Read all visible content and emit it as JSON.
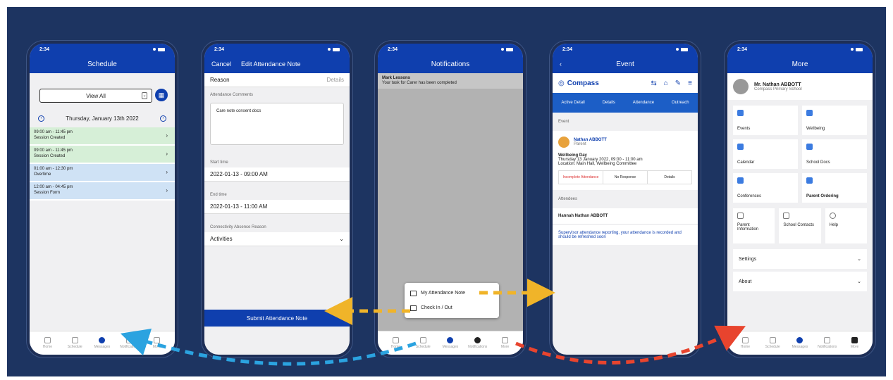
{
  "phone1": {
    "status_time": "2:34",
    "title": "Schedule",
    "dropdown_value": "View All",
    "date": "Thursday, January 13th 2022",
    "appointments": [
      {
        "line1": "09:00 am - 11:45 pm",
        "line2": "Session Created",
        "color": "green"
      },
      {
        "line1": "09:00 am - 11:45 pm",
        "line2": "Session Created",
        "color": "green"
      },
      {
        "line1": "01:00 am - 12:30 pm",
        "line2": "Overtime",
        "color": "blue"
      },
      {
        "line1": "12:00 am - 04:45 pm",
        "line2": "Session Form",
        "color": "blue"
      }
    ]
  },
  "phone2": {
    "status_time": "2:34",
    "cancel": "Cancel",
    "title": "Edit Attendance Note",
    "reason_label": "Reason",
    "reason_value": "Details",
    "notes_label": "Attendance Comments",
    "notes_value": "Care note consent docs",
    "start_label": "Start time",
    "start_value": "2022-01-13 - 09:00 AM",
    "end_label": "End time",
    "end_value": "2022-01-13 - 11:00 AM",
    "activity_label": "Connectivity Absence Reason",
    "activity_value": "Activities",
    "submit": "Submit Attendance Note"
  },
  "phone3": {
    "status_time": "2:34",
    "title": "Notifications",
    "notif_line1": "Mark Lessons",
    "notif_line2": "Your task for Carer has been completed",
    "popup_item1": "My Attendance Note",
    "popup_item2": "Check In / Out"
  },
  "phone4": {
    "status_time": "2:34",
    "title": "Event",
    "brand": "Compass",
    "subtabs": [
      "Active Detail",
      "Details",
      "Attendance",
      "Outreach"
    ],
    "section1": "Event",
    "person": "Nathan ABBOTT",
    "person_sub": "Parent",
    "event_title": "Wellbeing Day",
    "event_line1": "Thursday 13 January 2022, 09:00 - 11:00 am",
    "event_line2": "Location: Main Hall, Wellbeing Committee",
    "btn1": "Incomplete Attendance",
    "btn2": "No Response",
    "btn3": "Details",
    "section2": "Attendees",
    "attendee": "Hannah Nathan ABBOTT",
    "link": "Supervisor attendance reporting, your attendance is recorded and should be refreshed soon"
  },
  "phone5": {
    "status_time": "2:34",
    "title": "More",
    "name": "Mr. Nathan ABBOTT",
    "school": "Compass Primary School",
    "tiles": [
      "Events",
      "Wellbeing",
      "Calendar",
      "School Docs",
      "Conferences",
      "Parent Ordering"
    ],
    "small_tiles": [
      "Parent Information",
      "School Contacts",
      "Help"
    ],
    "expanders": [
      "Settings",
      "About"
    ]
  },
  "tabbar": {
    "labels": [
      "Home",
      "Schedule",
      "Messages",
      "Notifications",
      "More"
    ]
  },
  "colors": {
    "background": "#1d3461",
    "header_blue": "#0f3fae",
    "arrow_yellow": "#f0b429",
    "arrow_blue": "#2ba3e0",
    "arrow_red": "#e8442e"
  }
}
